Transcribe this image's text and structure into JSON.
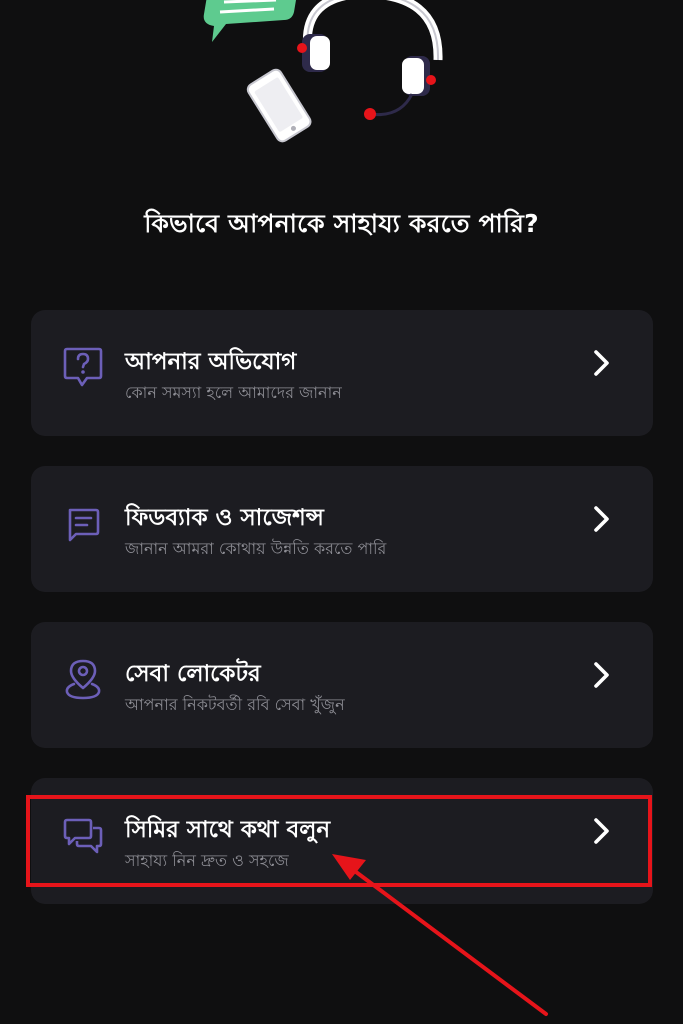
{
  "heading": "কিভাবে আপনাকে সাহায্য করতে পারি?",
  "colors": {
    "background": "#0f0f10",
    "card": "#1c1c21",
    "icon_accent": "#6c5fb8",
    "highlight": "#e6141a",
    "chat_bubble": "#5ecb8f"
  },
  "options": [
    {
      "title": "আপনার অভিযোগ",
      "subtitle": "কোন সমস্যা হলে আমাদের জানান",
      "icon": "question-bubble-icon"
    },
    {
      "title": "ফিডব্যাক ও সাজেশন্স",
      "subtitle": "জানান আমরা কোথায় উন্নতি করতে পারি",
      "icon": "message-lines-icon"
    },
    {
      "title": "সেবা লোকেটর",
      "subtitle": "আপনার নিকটবর্তী রবি সেবা খুঁজুন",
      "icon": "location-pin-icon"
    },
    {
      "title": "সিমির সাথে কথা বলুন",
      "subtitle": "সাহায্য নিন দ্রুত ও সহজে",
      "icon": "chat-bubbles-icon"
    }
  ]
}
